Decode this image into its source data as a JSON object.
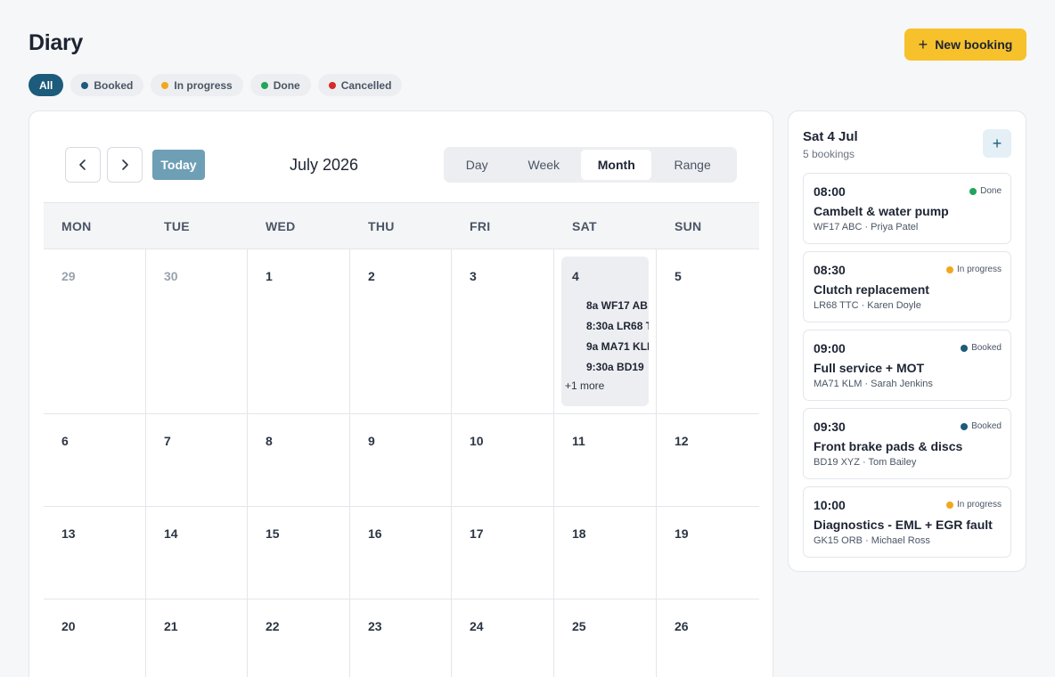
{
  "header": {
    "title": "Diary",
    "new_booking_label": "New booking"
  },
  "colors": {
    "booked": "#1c5b7b",
    "in_progress": "#f0a81c",
    "done": "#22a55b",
    "cancelled": "#d62a2a",
    "accent": "#f7c12c"
  },
  "filters": [
    {
      "label": "All",
      "active": true
    },
    {
      "label": "Booked",
      "dot": "#1c5b7b"
    },
    {
      "label": "In progress",
      "dot": "#f0a81c"
    },
    {
      "label": "Done",
      "dot": "#22a55b"
    },
    {
      "label": "Cancelled",
      "dot": "#d62a2a"
    }
  ],
  "calendar": {
    "today_label": "Today",
    "month_title": "July 2026",
    "views": [
      "Day",
      "Week",
      "Month",
      "Range"
    ],
    "active_view": "Month",
    "weekdays": [
      "MON",
      "TUE",
      "WED",
      "THU",
      "FRI",
      "SAT",
      "SUN"
    ],
    "weeks": [
      [
        "29",
        "30",
        "1",
        "2",
        "3",
        "4",
        "5"
      ],
      [
        "6",
        "7",
        "8",
        "9",
        "10",
        "11",
        "12"
      ],
      [
        "13",
        "14",
        "15",
        "16",
        "17",
        "18",
        "19"
      ],
      [
        "20",
        "21",
        "22",
        "23",
        "24",
        "25",
        "26"
      ]
    ],
    "muted_days": [
      "29",
      "30"
    ],
    "selected_day": "4",
    "selected_events": [
      "8a WF17 AB",
      "8:30a LR68 T",
      "9a MA71 KLM",
      "9:30a BD19"
    ],
    "more_label": "+1 more"
  },
  "side": {
    "title": "Sat 4 Jul",
    "subtitle": "5 bookings",
    "bookings": [
      {
        "time": "08:00",
        "status": "Done",
        "status_color": "#22a55b",
        "title": "Cambelt & water pump",
        "meta": "WF17 ABC · Priya Patel"
      },
      {
        "time": "08:30",
        "status": "In progress",
        "status_color": "#f0a81c",
        "title": "Clutch replacement",
        "meta": "LR68 TTC · Karen Doyle"
      },
      {
        "time": "09:00",
        "status": "Booked",
        "status_color": "#1c5b7b",
        "title": "Full service + MOT",
        "meta": "MA71 KLM · Sarah Jenkins"
      },
      {
        "time": "09:30",
        "status": "Booked",
        "status_color": "#1c5b7b",
        "title": "Front brake pads & discs",
        "meta": "BD19 XYZ · Tom Bailey"
      },
      {
        "time": "10:00",
        "status": "In progress",
        "status_color": "#f0a81c",
        "title": "Diagnostics - EML + EGR fault",
        "meta": "GK15 ORB · Michael Ross"
      }
    ]
  }
}
